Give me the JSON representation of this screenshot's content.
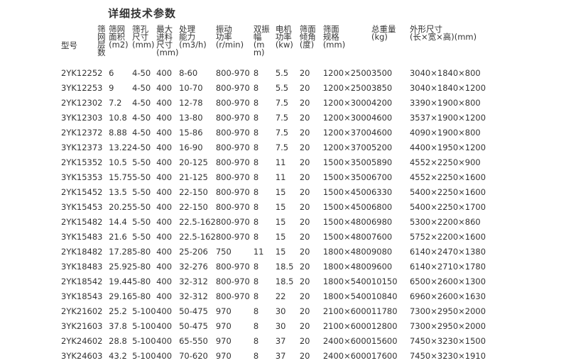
{
  "title": "详细技术参数",
  "headers": [
    "型号",
    "筛网层数",
    "筛网面积(m2)",
    "筛孔尺寸(mm)",
    "最大进料尺寸(mm)",
    "处理能力(m3/h)",
    "振动功率(r/min)",
    "双振幅(mm)",
    "电机功率(kw)",
    "筛面倾角(度)",
    "筛面规格(mm)",
    "总重量(kg)",
    "外形尺寸(长×宽×高)(mm)"
  ],
  "header_lines": [
    [
      "型号"
    ],
    [
      "筛",
      "网",
      "层",
      "数"
    ],
    [
      "筛网",
      "面积",
      "(m2)"
    ],
    [
      "筛孔",
      "尺寸",
      "(mm)"
    ],
    [
      "最大",
      "进料",
      "尺寸",
      "(mm)"
    ],
    [
      "处理",
      "能力",
      "(m3/h)"
    ],
    [
      "振动",
      "功率",
      "(r/min)"
    ],
    [
      "双振",
      "幅",
      "(mm)"
    ],
    [
      "电机",
      "功率",
      "(kw)"
    ],
    [
      "筛面",
      "倾角",
      "(度)"
    ],
    [
      "筛面",
      "规格",
      "(mm)"
    ],
    [
      "总重量",
      "(kg)"
    ],
    [
      "外形尺寸",
      "(长×宽×高)(mm)"
    ]
  ],
  "rows": [
    [
      "2YK1225",
      "2",
      "6",
      "4-50",
      "400",
      "8-60",
      "800-970",
      "8",
      "5.5",
      "20",
      "1200×2500",
      "3500",
      "3040×1840×800"
    ],
    [
      "3YK1225",
      "3",
      "9",
      "4-50",
      "400",
      "10-70",
      "800-970",
      "8",
      "5.5",
      "20",
      "1200×2500",
      "3850",
      "3040×1840×1200"
    ],
    [
      "2YK1230",
      "2",
      "7.2",
      "4-50",
      "400",
      "12-78",
      "800-970",
      "8",
      "7.5",
      "20",
      "1200×3000",
      "4200",
      "3390×1900×800"
    ],
    [
      "3YK1230",
      "3",
      "10.8",
      "4-50",
      "400",
      "13-80",
      "800-970",
      "8",
      "7.5",
      "20",
      "1200×3000",
      "4600",
      "3537×1900×1200"
    ],
    [
      "2YK1237",
      "2",
      "8.88",
      "4-50",
      "400",
      "15-86",
      "800-970",
      "8",
      "7.5",
      "20",
      "1200×3700",
      "4600",
      "4090×1900×800"
    ],
    [
      "3YK1237",
      "3",
      "13.22",
      "4-50",
      "400",
      "16-90",
      "800-970",
      "8",
      "7.5",
      "20",
      "1200×3700",
      "5200",
      "4400×1950×1200"
    ],
    [
      "2YK1535",
      "2",
      "10.5",
      "5-50",
      "400",
      "20-125",
      "800-970",
      "8",
      "11",
      "20",
      "1500×3500",
      "5890",
      "4552×2250×900"
    ],
    [
      "3YK1535",
      "3",
      "15.75",
      "5-50",
      "400",
      "21-125",
      "800-970",
      "8",
      "11",
      "20",
      "1500×3500",
      "6700",
      "4552×2250×1600"
    ],
    [
      "2YK1545",
      "2",
      "13.5",
      "5-50",
      "400",
      "22-150",
      "800-970",
      "8",
      "15",
      "20",
      "1500×4500",
      "6330",
      "5400×2250×1600"
    ],
    [
      "3YK1545",
      "3",
      "20.25",
      "5-50",
      "400",
      "22-150",
      "800-970",
      "8",
      "15",
      "20",
      "1500×4500",
      "6800",
      "5400×2250×1700"
    ],
    [
      "2YK1548",
      "2",
      "14.4",
      "5-50",
      "400",
      "22.5-162",
      "800-970",
      "8",
      "15",
      "20",
      "1500×4800",
      "6980",
      "5300×2200×860"
    ],
    [
      "3YK1548",
      "3",
      "21.6",
      "5-50",
      "400",
      "22.5-162",
      "800-970",
      "8",
      "15",
      "20",
      "1500×4800",
      "7600",
      "5752×2200×1600"
    ],
    [
      "2YK1848",
      "2",
      "17.28",
      "5-80",
      "400",
      "25-206",
      "750",
      "11",
      "15",
      "20",
      "1800×4800",
      "9080",
      "6140×2470×1380"
    ],
    [
      "3YK1848",
      "3",
      "25.92",
      "5-80",
      "400",
      "32-276",
      "800-970",
      "8",
      "18.5",
      "20",
      "1800×4800",
      "9600",
      "6140×2710×1780"
    ],
    [
      "2YK1854",
      "2",
      "19.44",
      "5-80",
      "400",
      "32-312",
      "800-970",
      "8",
      "18.5",
      "20",
      "1800×5400",
      "10150",
      "6500×2600×1300"
    ],
    [
      "3YK1854",
      "3",
      "29.16",
      "5-80",
      "400",
      "32-312",
      "800-970",
      "8",
      "22",
      "20",
      "1800×5400",
      "10840",
      "6960×2600×1630"
    ],
    [
      "2YK2160",
      "2",
      "25.2",
      "5-100",
      "400",
      "50-475",
      "970",
      "8",
      "30",
      "20",
      "2100×6000",
      "11780",
      "7300×2950×2000"
    ],
    [
      "3YK2160",
      "3",
      "37.8",
      "5-100",
      "400",
      "50-475",
      "970",
      "8",
      "30",
      "20",
      "2100×6000",
      "12800",
      "7300×2950×2000"
    ],
    [
      "2YK2460",
      "2",
      "28.8",
      "5-100",
      "400",
      "65-550",
      "970",
      "8",
      "37",
      "20",
      "2400×6000",
      "15600",
      "7450×3230×1500"
    ],
    [
      "3YK2460",
      "3",
      "43.2",
      "5-100",
      "400",
      "70-620",
      "970",
      "8",
      "37",
      "20",
      "2400×6000",
      "17600",
      "7450×3230×1910"
    ]
  ]
}
